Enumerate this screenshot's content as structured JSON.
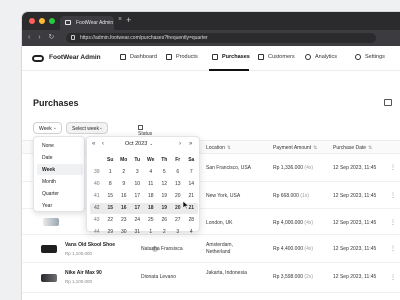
{
  "browser": {
    "tab_title": "FootWear Admin",
    "url": "https://admin.footwear.com/purchases?frequently=quarter"
  },
  "app": {
    "name": "FootWear Admin",
    "nav": [
      {
        "label": "Dashboard",
        "icon": "grid-icon"
      },
      {
        "label": "Products",
        "icon": "box-icon"
      },
      {
        "label": "Purchases",
        "icon": "cart-icon",
        "active": true
      },
      {
        "label": "Customers",
        "icon": "users-icon"
      },
      {
        "label": "Analytics",
        "icon": "chart-icon"
      },
      {
        "label": "Settings",
        "icon": "gear-icon"
      }
    ]
  },
  "page": {
    "title": "Purchases",
    "filters": {
      "period": "Week",
      "select_week": "Select week",
      "status": "Status"
    }
  },
  "period_menu": {
    "items": [
      "None",
      "Date",
      "Week",
      "Month",
      "Quarter",
      "Year"
    ],
    "selected": "Week"
  },
  "calendar": {
    "month": "Oct 2023",
    "headers": [
      "Su",
      "Mo",
      "Tu",
      "We",
      "Th",
      "Fr",
      "Sa"
    ],
    "weeks": [
      [
        "39",
        "1",
        "2",
        "3",
        "4",
        "5",
        "6",
        "7"
      ],
      [
        "40",
        "8",
        "9",
        "10",
        "11",
        "12",
        "13",
        "14"
      ],
      [
        "41",
        "15",
        "16",
        "17",
        "18",
        "19",
        "20",
        "21"
      ],
      [
        "42",
        "15",
        "16",
        "17",
        "18",
        "19",
        "20",
        "21"
      ],
      [
        "43",
        "22",
        "23",
        "24",
        "25",
        "26",
        "27",
        "28"
      ],
      [
        "44",
        "29",
        "30",
        "31",
        "1",
        "2",
        "3",
        "4"
      ]
    ],
    "highlighted_week": "42"
  },
  "table": {
    "columns": [
      "Location",
      "Payment Amount",
      "Purchase Date"
    ],
    "rows": [
      {
        "product": "",
        "price": "",
        "customer": "",
        "location": "San Francisco, USA",
        "amount": "Rp 1,336.000",
        "qty": "(4x)",
        "date": "12 Sep 2023, 11:45"
      },
      {
        "product": "",
        "price": "",
        "customer": "",
        "location": "New York, USA",
        "amount": "Rp 668.000",
        "qty": "(1x)",
        "date": "12 Sep 2023, 11:45"
      },
      {
        "product": "",
        "price": "",
        "customer": "",
        "location": "London, UK",
        "amount": "Rp 4,000.000",
        "qty": "(4x)",
        "date": "12 Sep 2023, 11:45"
      },
      {
        "product": "Vans Old Skool Shoe",
        "price": "Rp 1,100.000",
        "customer": "Natasha Fransisca",
        "location": "Amsterdam, Netherland",
        "amount": "Rp 4,400.000",
        "qty": "(4x)",
        "date": "12 Sep 2023, 11:45"
      },
      {
        "product": "Nike Air Max 90",
        "price": "Rp 1,100.000",
        "customer": "Dionata Levano",
        "location": "Jakarta, Indonesia",
        "amount": "Rp 3,598.000",
        "qty": "(2x)",
        "date": "12 Sep 2023, 11:45"
      }
    ]
  },
  "colors": {
    "accent": "#111111",
    "highlight": "#ebebec"
  }
}
